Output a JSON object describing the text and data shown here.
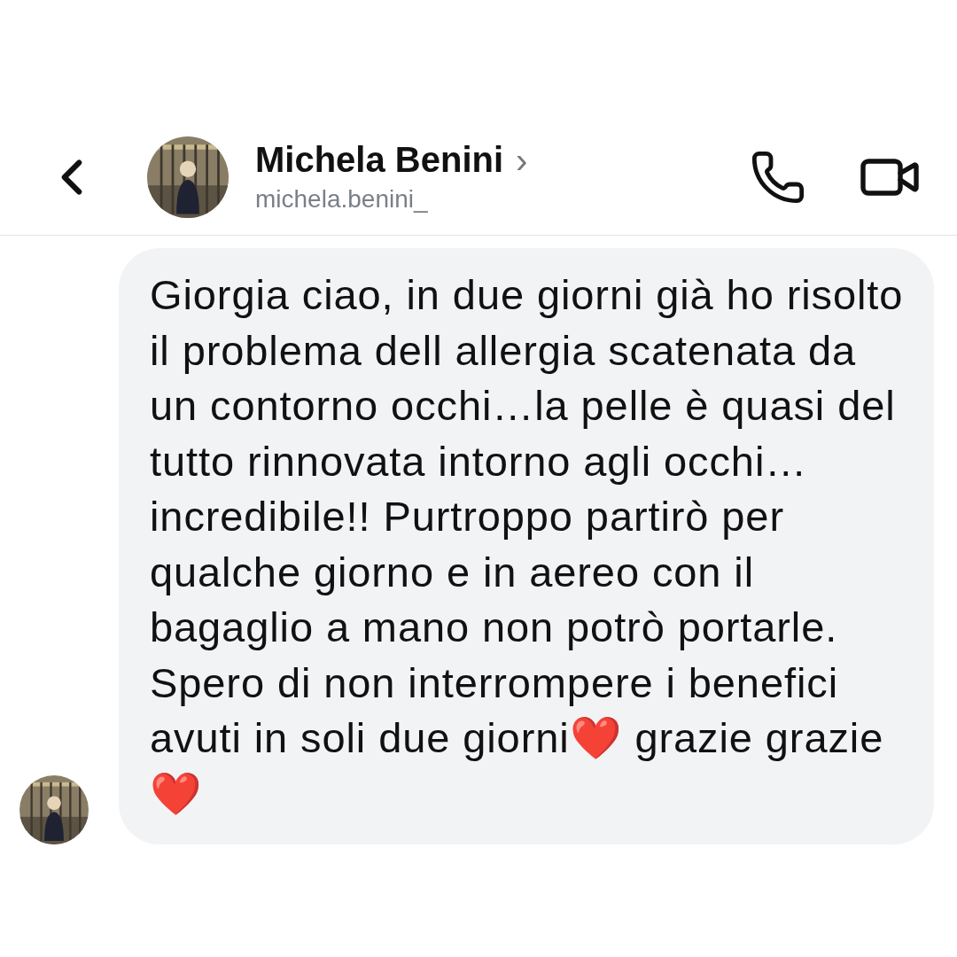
{
  "header": {
    "name": "Michela Benini",
    "name_chevron": "›",
    "username": "michela.benini_"
  },
  "messages": [
    {
      "kind": "incoming",
      "text": "Giorgia ciao, in due giorni già ho risolto il problema dell allergia scatenata da un contorno occhi…la pelle è quasi del tutto rinnovata intorno agli occhi… incredibile!! Purtroppo partirò per qualche giorno e in aereo con il bagaglio a mano non potrò portarle. Spero di non interrompere i benefici avuti in soli due giorni❤️ grazie grazie ❤️"
    }
  ]
}
